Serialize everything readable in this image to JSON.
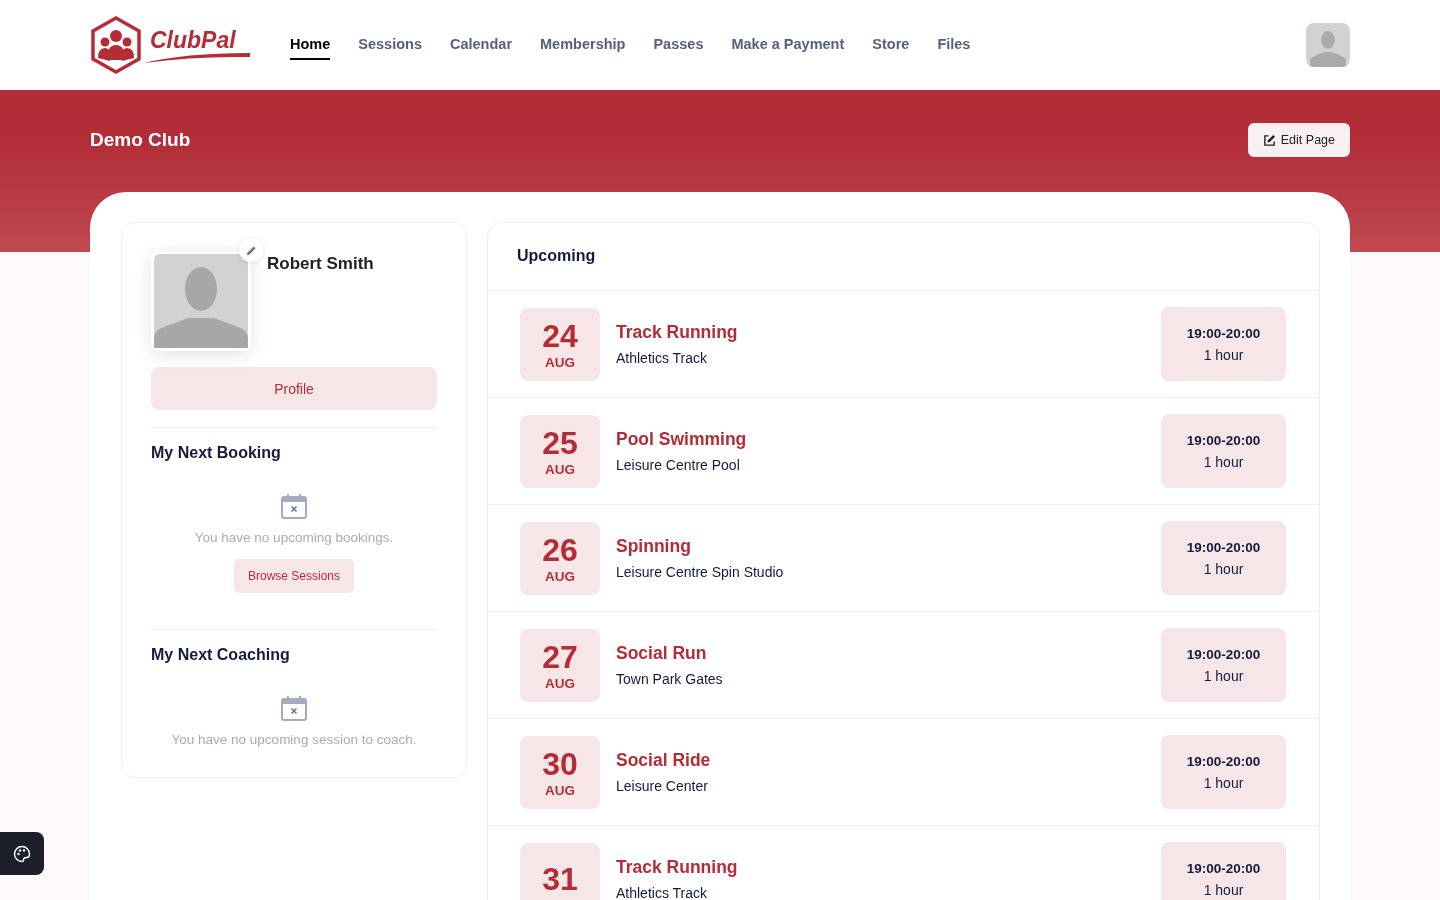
{
  "brand": {
    "name": "ClubPal"
  },
  "nav": [
    {
      "label": "Home",
      "selected": true
    },
    {
      "label": "Sessions",
      "selected": false
    },
    {
      "label": "Calendar",
      "selected": false
    },
    {
      "label": "Membership",
      "selected": false
    },
    {
      "label": "Passes",
      "selected": false
    },
    {
      "label": "Make a Payment",
      "selected": false
    },
    {
      "label": "Store",
      "selected": false
    },
    {
      "label": "Files",
      "selected": false
    }
  ],
  "banner": {
    "title": "Demo Club",
    "edit_button": "Edit Page"
  },
  "profile": {
    "name": "Robert Smith",
    "button": "Profile"
  },
  "next_booking": {
    "title": "My Next Booking",
    "empty_text": "You have no upcoming bookings.",
    "button": "Browse Sessions"
  },
  "next_coaching": {
    "title": "My Next Coaching",
    "empty_text": "You have no upcoming session to coach."
  },
  "upcoming": {
    "title": "Upcoming",
    "events": [
      {
        "day": "24",
        "month": "AUG",
        "name": "Track Running",
        "location": "Athletics Track",
        "time": "19:00-20:00",
        "duration": "1 hour"
      },
      {
        "day": "25",
        "month": "AUG",
        "name": "Pool Swimming",
        "location": "Leisure Centre Pool",
        "time": "19:00-20:00",
        "duration": "1 hour"
      },
      {
        "day": "26",
        "month": "AUG",
        "name": "Spinning",
        "location": "Leisure Centre Spin Studio",
        "time": "19:00-20:00",
        "duration": "1 hour"
      },
      {
        "day": "27",
        "month": "AUG",
        "name": "Social Run",
        "location": "Town Park Gates",
        "time": "19:00-20:00",
        "duration": "1 hour"
      },
      {
        "day": "30",
        "month": "AUG",
        "name": "Social Ride",
        "location": "Leisure Center",
        "time": "19:00-20:00",
        "duration": "1 hour"
      },
      {
        "day": "31",
        "name": "Track Running",
        "location": "Athletics Track",
        "time": "19:00-20:00",
        "duration": "1 hour"
      }
    ]
  }
}
